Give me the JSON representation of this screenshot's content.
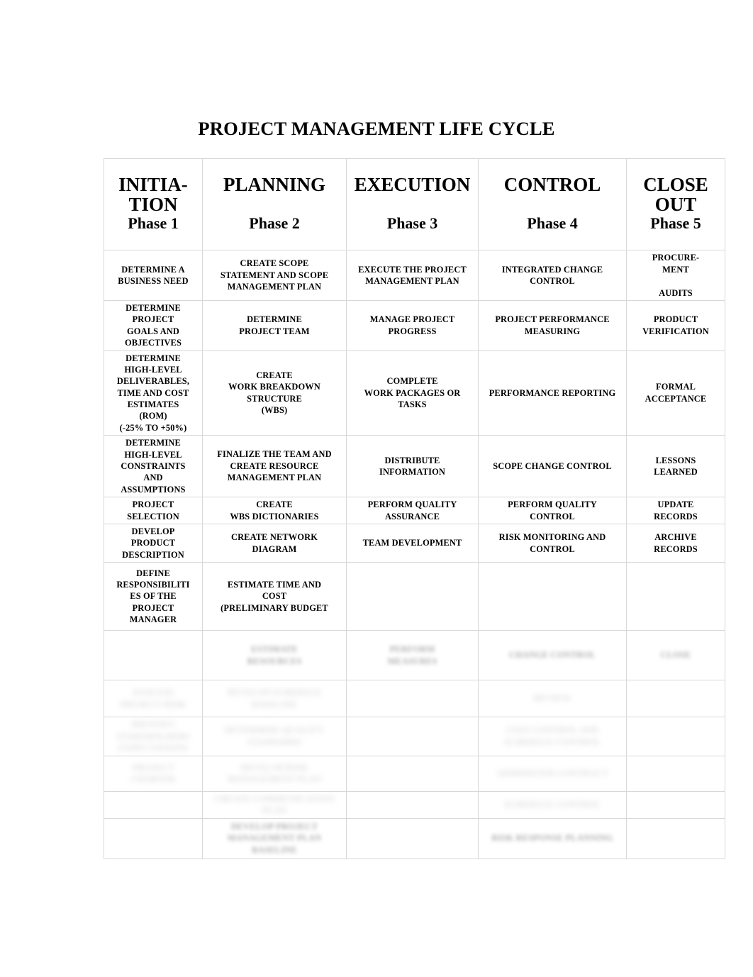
{
  "document": {
    "title": "PROJECT MANAGEMENT LIFE CYCLE"
  },
  "table": {
    "columns": [
      {
        "key": "initiation",
        "phase_name": "INITIA-\nTION",
        "phase_name_line1": "INITIA-",
        "phase_name_line2": "TION",
        "phase_number": "Phase 1"
      },
      {
        "key": "planning",
        "phase_name": "PLANNING",
        "phase_name_line1": "PLANNING",
        "phase_name_line2": "",
        "phase_number": "Phase 2"
      },
      {
        "key": "execution",
        "phase_name": "EXECUTION",
        "phase_name_line1": "EXECUTION",
        "phase_name_line2": "",
        "phase_number": "Phase 3"
      },
      {
        "key": "control",
        "phase_name": "CONTROL",
        "phase_name_line1": "CONTROL",
        "phase_name_line2": "",
        "phase_number": "Phase 4"
      },
      {
        "key": "closeout",
        "phase_name": "CLOSE OUT",
        "phase_name_line1": "CLOSE",
        "phase_name_line2": "OUT",
        "phase_number": "Phase 5"
      }
    ],
    "rows": [
      {
        "initiation": [
          "DETERMINE A",
          "BUSINESS NEED"
        ],
        "planning": [
          "CREATE SCOPE",
          "STATEMENT AND SCOPE",
          "MANAGEMENT PLAN"
        ],
        "execution": [
          "EXECUTE THE PROJECT",
          "MANAGEMENT PLAN"
        ],
        "control": [
          "INTEGRATED CHANGE",
          "CONTROL"
        ],
        "closeout": [
          "PROCURE-",
          "MENT",
          "",
          "AUDITS"
        ]
      },
      {
        "initiation": [
          "DETERMINE",
          "PROJECT",
          "GOALS AND",
          "OBJECTIVES"
        ],
        "planning": [
          "DETERMINE",
          "PROJECT TEAM"
        ],
        "execution": [
          "MANAGE PROJECT",
          "PROGRESS"
        ],
        "control": [
          "PROJECT PERFORMANCE",
          "MEASURING"
        ],
        "closeout": [
          "PRODUCT",
          "VERIFICATION"
        ]
      },
      {
        "initiation": [
          "DETERMINE",
          "HIGH-LEVEL",
          "DELIVERABLES,",
          "TIME AND COST",
          "ESTIMATES",
          "(ROM)",
          "(-25% TO +50%)"
        ],
        "planning": [
          "CREATE",
          "WORK BREAKDOWN",
          "STRUCTURE",
          "(WBS)"
        ],
        "execution": [
          "COMPLETE",
          "WORK PACKAGES OR",
          "TASKS"
        ],
        "control": [
          "PERFORMANCE REPORTING"
        ],
        "closeout": [
          "FORMAL",
          "ACCEPTANCE"
        ]
      },
      {
        "initiation": [
          "DETERMINE",
          "HIGH-LEVEL",
          "CONSTRAINTS",
          "AND",
          "ASSUMPTIONS"
        ],
        "planning": [
          "FINALIZE THE TEAM AND",
          "CREATE RESOURCE",
          "MANAGEMENT PLAN"
        ],
        "execution": [
          "DISTRIBUTE",
          "INFORMATION"
        ],
        "control": [
          "SCOPE CHANGE CONTROL"
        ],
        "closeout": [
          "LESSONS",
          "LEARNED"
        ]
      },
      {
        "initiation": [
          "PROJECT",
          "SELECTION"
        ],
        "planning": [
          "CREATE",
          "WBS DICTIONARIES"
        ],
        "execution": [
          "PERFORM QUALITY",
          "ASSURANCE"
        ],
        "control": [
          "PERFORM QUALITY",
          "CONTROL"
        ],
        "closeout": [
          "UPDATE",
          "RECORDS"
        ]
      },
      {
        "initiation": [
          "DEVELOP",
          "PRODUCT",
          "DESCRIPTION"
        ],
        "planning": [
          "CREATE NETWORK",
          "DIAGRAM"
        ],
        "execution": [
          "TEAM DEVELOPMENT"
        ],
        "control": [
          "RISK MONITORING AND",
          "CONTROL"
        ],
        "closeout": [
          "ARCHIVE",
          "RECORDS"
        ]
      },
      {
        "initiation": [
          "DEFINE",
          "RESPONSIBILITI",
          "ES OF THE",
          "PROJECT",
          "MANAGER"
        ],
        "planning": [
          "ESTIMATE TIME AND",
          "COST",
          "(PRELIMINARY BUDGET"
        ],
        "execution": [],
        "control": [],
        "closeout": []
      }
    ],
    "degraded_rows_note": "lower table rows are illegible in the scan",
    "degraded_rows": [
      {
        "initiation": [
          ""
        ],
        "planning": [
          "ESTIMATE",
          "RESOURCES"
        ],
        "execution": [
          "PERFORM",
          "MEASURES"
        ],
        "control": [
          "CHANGE CONTROL"
        ],
        "closeout": [
          "CLOSE"
        ]
      },
      {
        "initiation": [
          "ANALYZE",
          "PROJECT RISK"
        ],
        "planning": [
          "DEVELOP SCHEDULE",
          "BASELINE"
        ],
        "execution": [
          ""
        ],
        "control": [
          "REVIEW"
        ],
        "closeout": [
          ""
        ]
      },
      {
        "initiation": [
          "IDENTIFY",
          "STAKEHOLDERS",
          "EXPECTATIONS"
        ],
        "planning": [
          "DETERMINE QUALITY",
          "STANDARDS"
        ],
        "execution": [
          ""
        ],
        "control": [
          "COST CONTROL AND",
          "SCHEDULE CONTROL"
        ],
        "closeout": [
          ""
        ]
      },
      {
        "initiation": [
          "PROJECT",
          "CHARTER"
        ],
        "planning": [
          "DEVELOP RISK",
          "MANAGEMENT PLAN"
        ],
        "execution": [
          ""
        ],
        "control": [
          "ADMINISTER CONTRACT"
        ],
        "closeout": [
          ""
        ]
      },
      {
        "initiation": [
          ""
        ],
        "planning": [
          "CREATE COMMUNICATION",
          "PLAN"
        ],
        "execution": [
          ""
        ],
        "control": [
          "SCHEDULE CONTROL"
        ],
        "closeout": [
          ""
        ]
      },
      {
        "initiation": [
          ""
        ],
        "planning": [
          "DEVELOP PROJECT",
          "MANAGEMENT PLAN",
          "BASELINE"
        ],
        "execution": [
          ""
        ],
        "control": [
          "RISK RESPONSE PLANNING"
        ],
        "closeout": [
          ""
        ]
      }
    ]
  },
  "style": {
    "border_color": "#d8d8d8",
    "text_color": "#000000",
    "faded_text_color": "#9c9c9c",
    "page_background": "#ffffff"
  }
}
